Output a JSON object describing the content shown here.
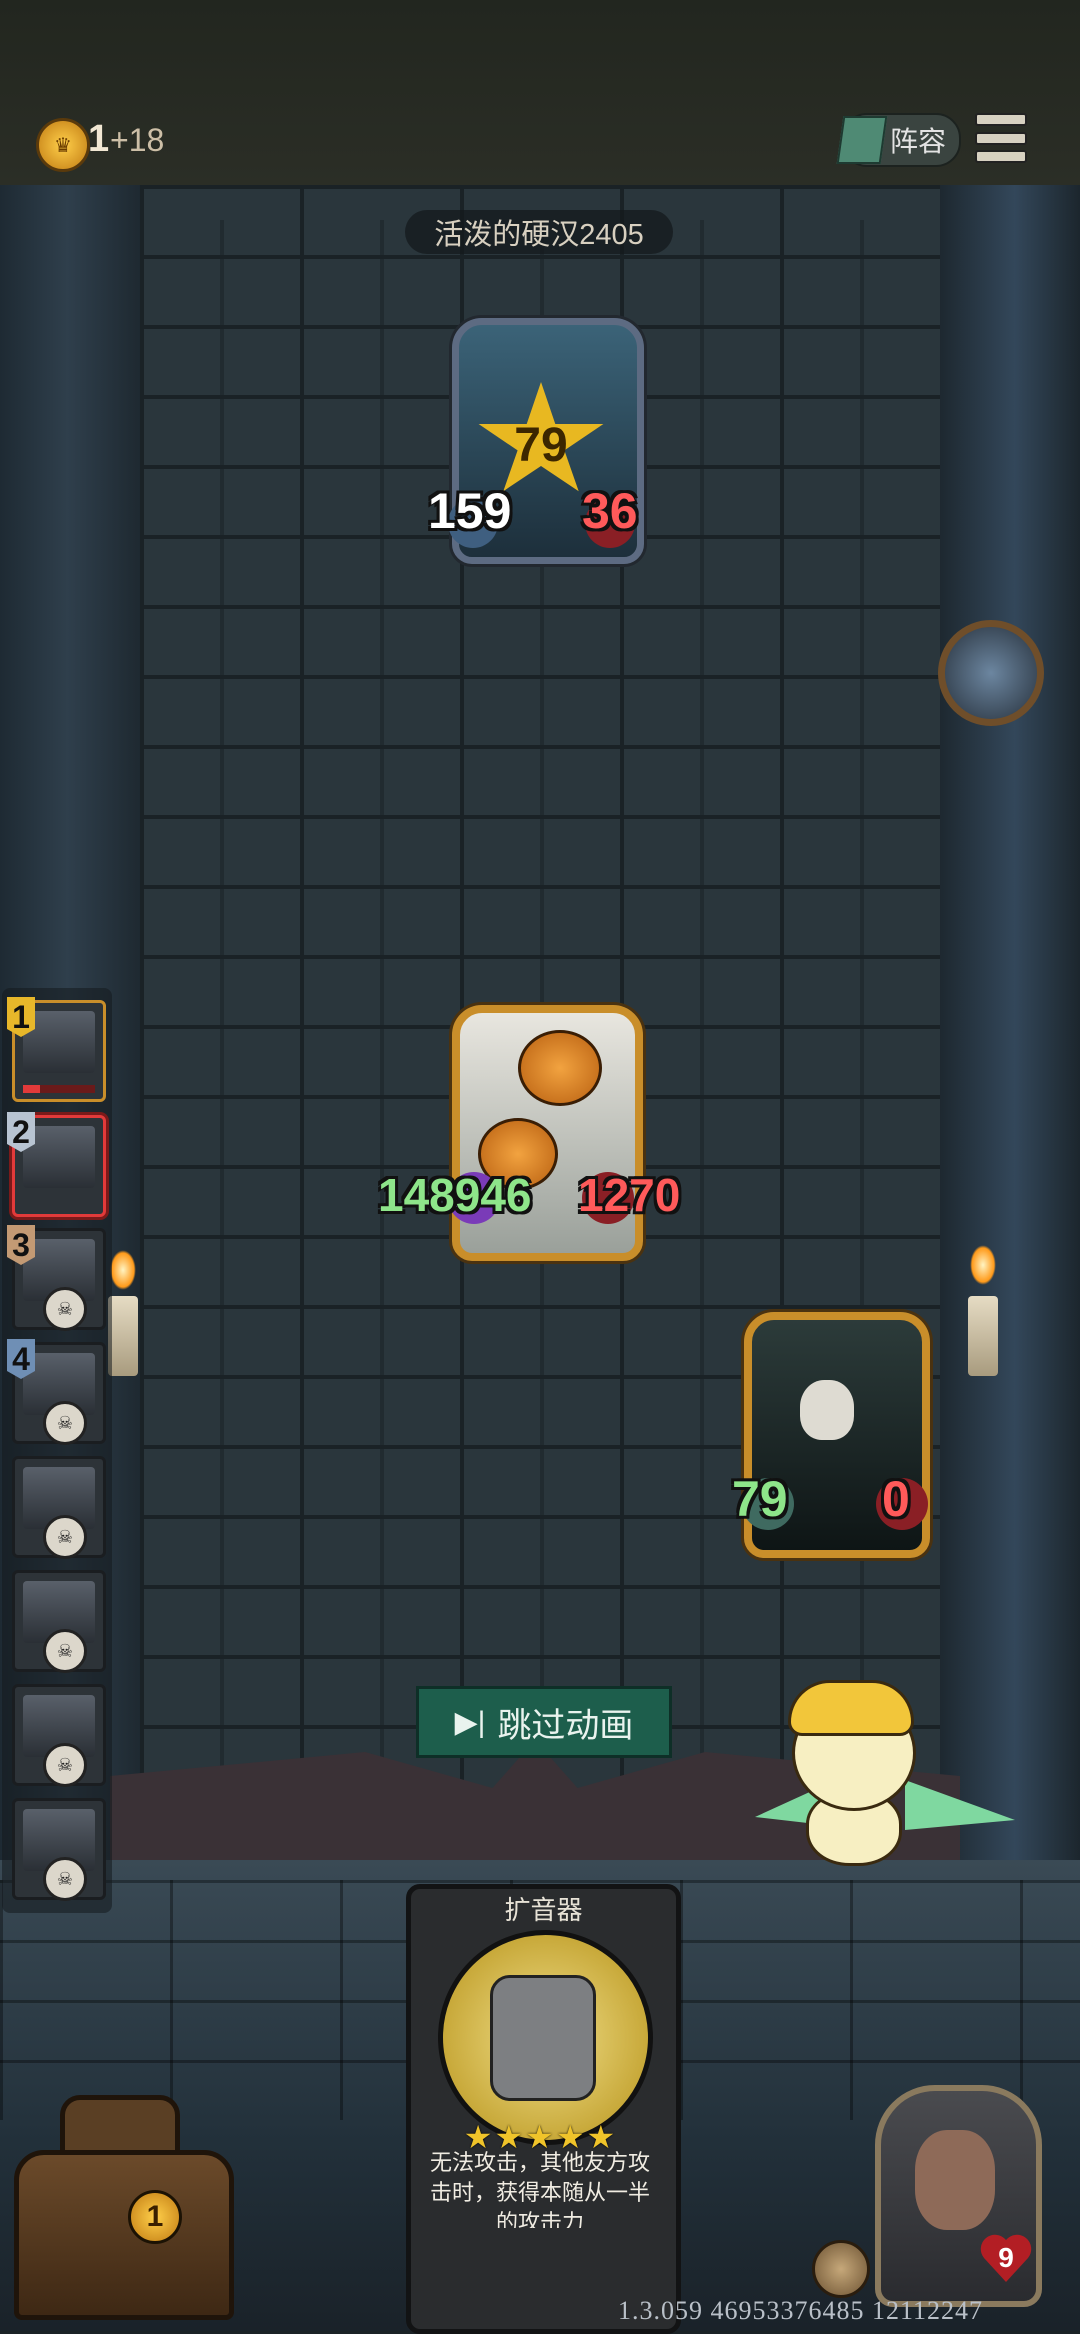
{
  "top_bar": {
    "coins": "1",
    "coin_bonus": "+18",
    "lineup_label": "阵容"
  },
  "opponent": {
    "name": "活泼的硬汉2405",
    "level": "79",
    "attack": "159",
    "health": "36"
  },
  "board": {
    "pumpkin_unit": {
      "attack": "148946",
      "health": "1270"
    },
    "reaper_unit": {
      "attack": "79",
      "health": "0"
    }
  },
  "skip_button_label": "跳过动画",
  "roster": {
    "slots": [
      {
        "number": "1"
      },
      {
        "number": "2"
      },
      {
        "number": "3"
      },
      {
        "number": "4"
      }
    ]
  },
  "item_card": {
    "title": "扩音器",
    "stars": "★★★★★",
    "description": "无法攻击，其他友方攻击时，获得本随从一半的攻击力"
  },
  "chest_count": "1",
  "hero_health": "9",
  "version": "1.3.059 46953376485 12112247",
  "colors": {
    "gold_frame": "#c98e2a",
    "skip_button": "#1d5e4c",
    "health_red": "#ff5a5a",
    "attack_green": "#8ee58a"
  },
  "icons": [
    "crown-coin-icon",
    "lineup-book-icon",
    "menu-icon",
    "pocket-watch-icon",
    "skip-icon",
    "skull-icon",
    "chest-icon",
    "heart-icon"
  ]
}
